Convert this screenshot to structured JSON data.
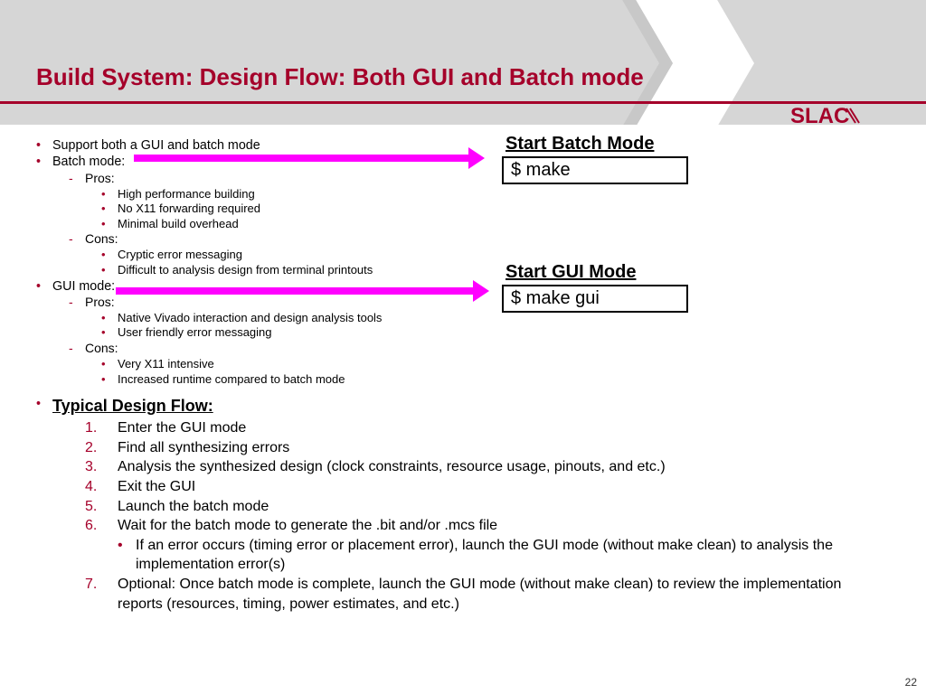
{
  "title": "Build System: Design Flow: Both GUI and Batch mode",
  "logo_text": "SLAC",
  "page_number": "22",
  "bullets": {
    "b1": "Support both a GUI and batch mode",
    "b2": "Batch mode:",
    "b2_pros": "Pros:",
    "b2_p1": "High performance building",
    "b2_p2": "No X11 forwarding required",
    "b2_p3": "Minimal build overhead",
    "b2_cons": "Cons:",
    "b2_c1": "Cryptic error messaging",
    "b2_c2": "Difficult to analysis design from terminal printouts",
    "b3": "GUI mode:",
    "b3_pros": "Pros:",
    "b3_p1": "Native Vivado interaction and design analysis tools",
    "b3_p2": "User friendly error messaging",
    "b3_cons": "Cons:",
    "b3_c1": "Very X11 intensive",
    "b3_c2": "Increased runtime compared to batch mode"
  },
  "flow": {
    "title": "Typical Design Flow:",
    "s1": "Enter the GUI mode",
    "s2": "Find all synthesizing errors",
    "s3": "Analysis the synthesized design (clock constraints, resource usage, pinouts, and etc.)",
    "s4": "Exit the GUI",
    "s5": "Launch the batch mode",
    "s6": "Wait for the batch mode to generate the .bit and/or .mcs file",
    "s6_sub": "If an error occurs (timing error or placement error), launch the GUI mode (without make clean) to analysis the implementation error(s)",
    "s7": "Optional: Once batch mode is complete, launch the GUI mode (without make clean) to review the implementation reports (resources, timing, power estimates, and etc.)"
  },
  "batch": {
    "title": "Start Batch Mode",
    "cmd": "$ make"
  },
  "gui": {
    "title": "Start GUI Mode",
    "cmd": "$ make gui"
  }
}
